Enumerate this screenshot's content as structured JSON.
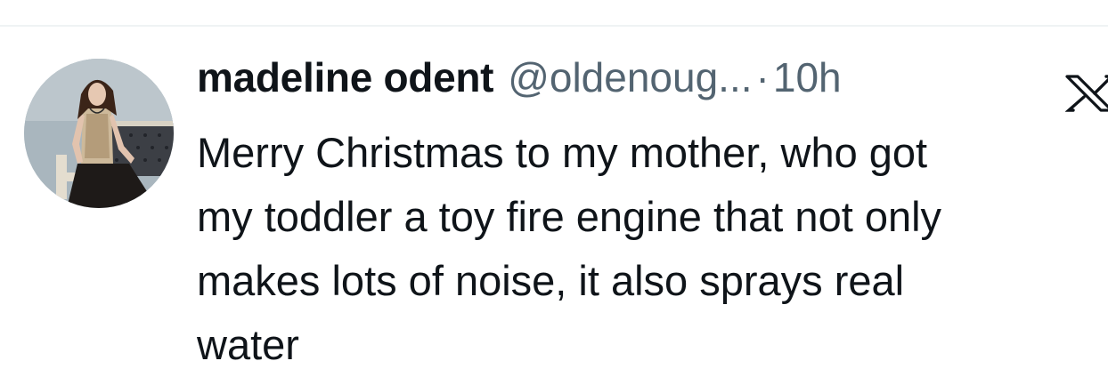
{
  "tweet": {
    "author": {
      "display_name": "madeline odent",
      "handle": "@oldenoug...",
      "avatar_icon": "profile-photo"
    },
    "separator": "·",
    "timestamp": "10h",
    "platform_icon": "x-logo-icon",
    "text": "Merry Christmas to my mother, who got\nmy toddler a toy fire engine that not only\nmakes lots of noise, it also sprays real\nwater"
  },
  "colors": {
    "text_primary": "#0f1419",
    "text_secondary": "#536471",
    "divider": "#eff3f4",
    "background": "#ffffff"
  }
}
